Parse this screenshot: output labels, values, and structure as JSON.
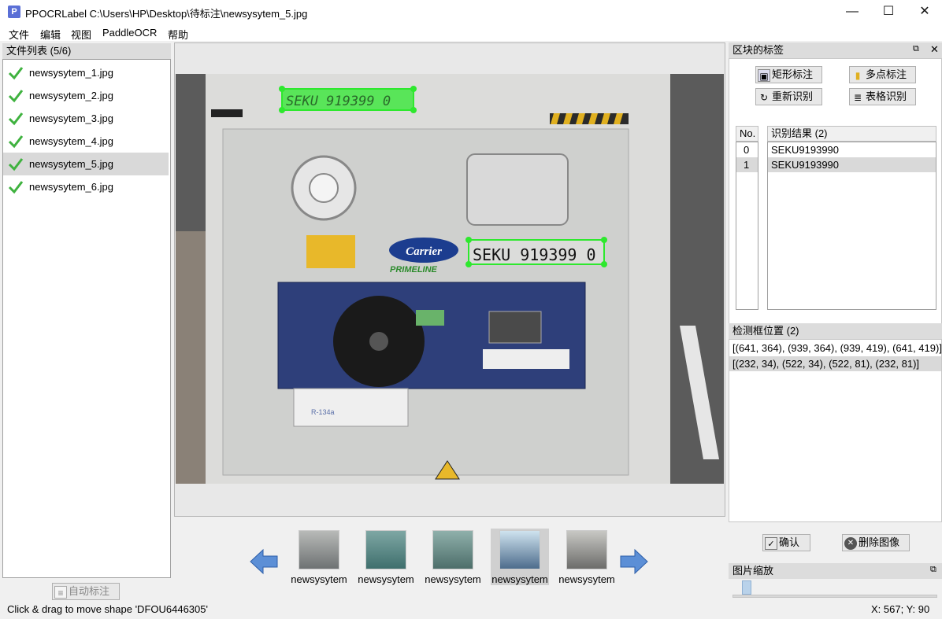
{
  "window": {
    "title": "PPOCRLabel C:\\Users\\HP\\Desktop\\待标注\\newsysytem_5.jpg",
    "app_icon_letter": "P",
    "minimize": "—",
    "maximize": "☐",
    "close": "✕"
  },
  "menu": [
    "文件",
    "编辑",
    "视图",
    "PaddleOCR",
    "帮助"
  ],
  "file_list": {
    "header": "文件列表 (5/6)",
    "items": [
      "newsysytem_1.jpg",
      "newsysytem_2.jpg",
      "newsysytem_3.jpg",
      "newsysytem_4.jpg",
      "newsysytem_5.jpg",
      "newsysytem_6.jpg"
    ],
    "selected_index": 4,
    "auto_label_button": "自动标注"
  },
  "canvas": {
    "boxes": [
      {
        "text": "SEKU 919399 0",
        "state": "selected"
      },
      {
        "text": "SEKU 919399 0",
        "state": "outline"
      }
    ],
    "image_text": {
      "brand": "Carrier",
      "sub_brand": "PRIMELINE",
      "tag": "R-134a"
    }
  },
  "thumbnails": {
    "labels": [
      "newsysytem",
      "newsysytem",
      "newsysytem",
      "newsysytem",
      "newsysytem"
    ],
    "selected_index": 3,
    "prev_icon": "left-arrow-icon",
    "next_icon": "right-arrow-icon"
  },
  "labels_panel": {
    "header": "区块的标签",
    "buttons": {
      "rect": "矩形标注",
      "poly": "多点标注",
      "reocr": "重新识别",
      "table": "表格识别"
    },
    "col_no": "No.",
    "col_result": "识别结果 (2)",
    "rows": [
      {
        "no": "0",
        "text": "SEKU9193990"
      },
      {
        "no": "1",
        "text": "SEKU9193990"
      }
    ],
    "selected_row": 1
  },
  "box_positions": {
    "header": "检测框位置 (2)",
    "rows": [
      "[(641, 364), (939, 364), (939, 419), (641, 419)]",
      "[(232, 34), (522, 34), (522, 81), (232, 81)]"
    ],
    "selected_row": 1
  },
  "actions": {
    "confirm": "确认",
    "delete": "删除图像"
  },
  "zoom": {
    "header": "图片缩放",
    "level": 0.05
  },
  "status": {
    "message": "Click & drag to move shape 'DFOU6446305'",
    "coords": "X: 567; Y: 90"
  },
  "colors": {
    "box_green": "#2ee82e",
    "selection_gray": "#d9d9d9"
  }
}
